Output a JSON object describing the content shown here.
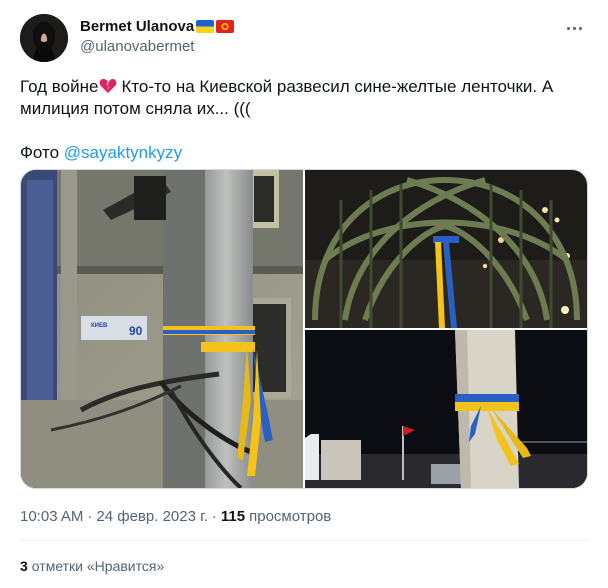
{
  "author": {
    "display_name": "Bermet Ulanova",
    "handle": "@ulanovabermet",
    "flags": [
      "flag-ukraine-icon",
      "flag-kyrgyzstan-icon"
    ]
  },
  "tweet": {
    "line1_before": "Год войне",
    "line1_after": "Кто-то на Киевской развесил сине-желтые ленточки. А",
    "line2": "милиция потом сняла их... (((",
    "photo_prefix": "Фото ",
    "photo_mention": "@sayaktynkyzy"
  },
  "photos": {
    "p1": {
      "sign_street": "КИЕВ",
      "sign_number": "90"
    }
  },
  "meta": {
    "time": "10:03 AM",
    "separator": "·",
    "date": "24 февр. 2023 г.",
    "views_count": "115",
    "views_label": "просмотров"
  },
  "engagement": {
    "likes_count": "3",
    "likes_label": "отметки «Нравится»"
  },
  "colors": {
    "link": "#1d9bf0",
    "secondary_text": "#536471",
    "ribbon_blue": "#2b5fc4",
    "ribbon_yellow": "#f4c31b"
  }
}
